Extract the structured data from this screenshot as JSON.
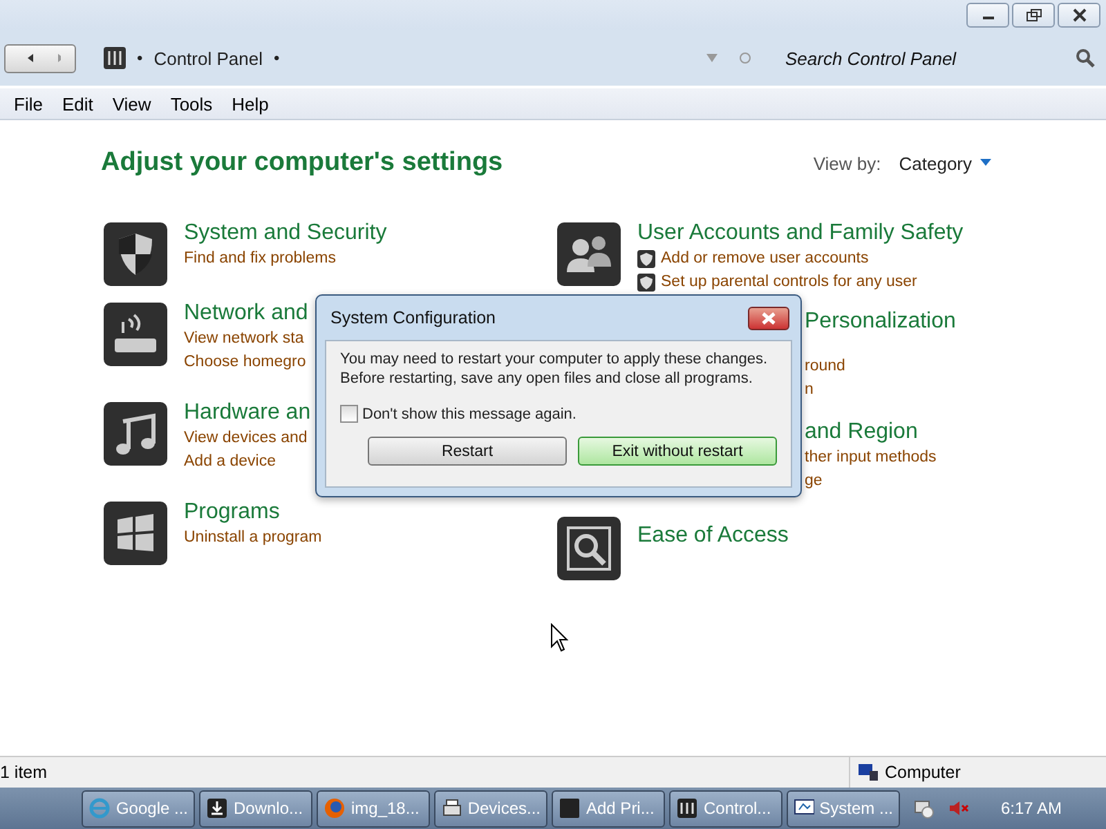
{
  "address_bar": {
    "lead_separator": "•",
    "path": "Control Panel",
    "trail_separator": "•",
    "search": {
      "placeholder": "Search Control Panel"
    }
  },
  "menu": [
    "File",
    "Edit",
    "View",
    "Tools",
    "Help"
  ],
  "heading": "Adjust your computer's settings",
  "view_by": {
    "label": "View by:",
    "value": "Category"
  },
  "categories_left": [
    {
      "kind": "shield",
      "title": "System and Security",
      "links": [
        "Find and fix problems"
      ]
    },
    {
      "kind": "router",
      "title": "Network and",
      "links": [
        "View network sta",
        "Choose homegro"
      ]
    },
    {
      "kind": "music",
      "title": "Hardware an",
      "links": [
        "View devices and",
        "Add a device"
      ]
    },
    {
      "kind": "windows",
      "title": "Programs",
      "links": [
        "Uninstall a program"
      ]
    }
  ],
  "categories_right": [
    {
      "kind": "users",
      "title": "User Accounts and Family Safety",
      "links": [
        "Add or remove user accounts",
        "Set up parental controls for any user"
      ]
    },
    {
      "kind": "partial",
      "title": "Personalization",
      "links": [
        "round",
        "n"
      ]
    },
    {
      "kind": "partial",
      "title": "and Region",
      "links": [
        "ther input methods",
        "ge"
      ]
    },
    {
      "kind": "magnifier",
      "title": "Ease of Access"
    }
  ],
  "dialog": {
    "title": "System Configuration",
    "message": [
      "You may need to restart your computer to apply these changes.",
      "Before restarting, save any open files and close all programs."
    ],
    "checkbox": {
      "label": "Don't show this message again.",
      "checked": false
    },
    "buttons": [
      {
        "label": "Restart",
        "default": false
      },
      {
        "label": "Exit without restart",
        "default": true
      }
    ]
  },
  "status_bar": {
    "count": "1 item",
    "location": "Computer"
  },
  "taskbar": {
    "buttons": [
      {
        "kind": "ie",
        "label": "Google ..."
      },
      {
        "kind": "download",
        "label": "Downlo..."
      },
      {
        "kind": "firefox",
        "label": "img_18..."
      },
      {
        "kind": "printer",
        "label": "Devices..."
      },
      {
        "kind": "blank",
        "label": "Add Pri..."
      },
      {
        "kind": "panel",
        "label": "Control..."
      },
      {
        "kind": "monitor",
        "label": "System ..."
      }
    ],
    "clock": "6:17 AM"
  }
}
